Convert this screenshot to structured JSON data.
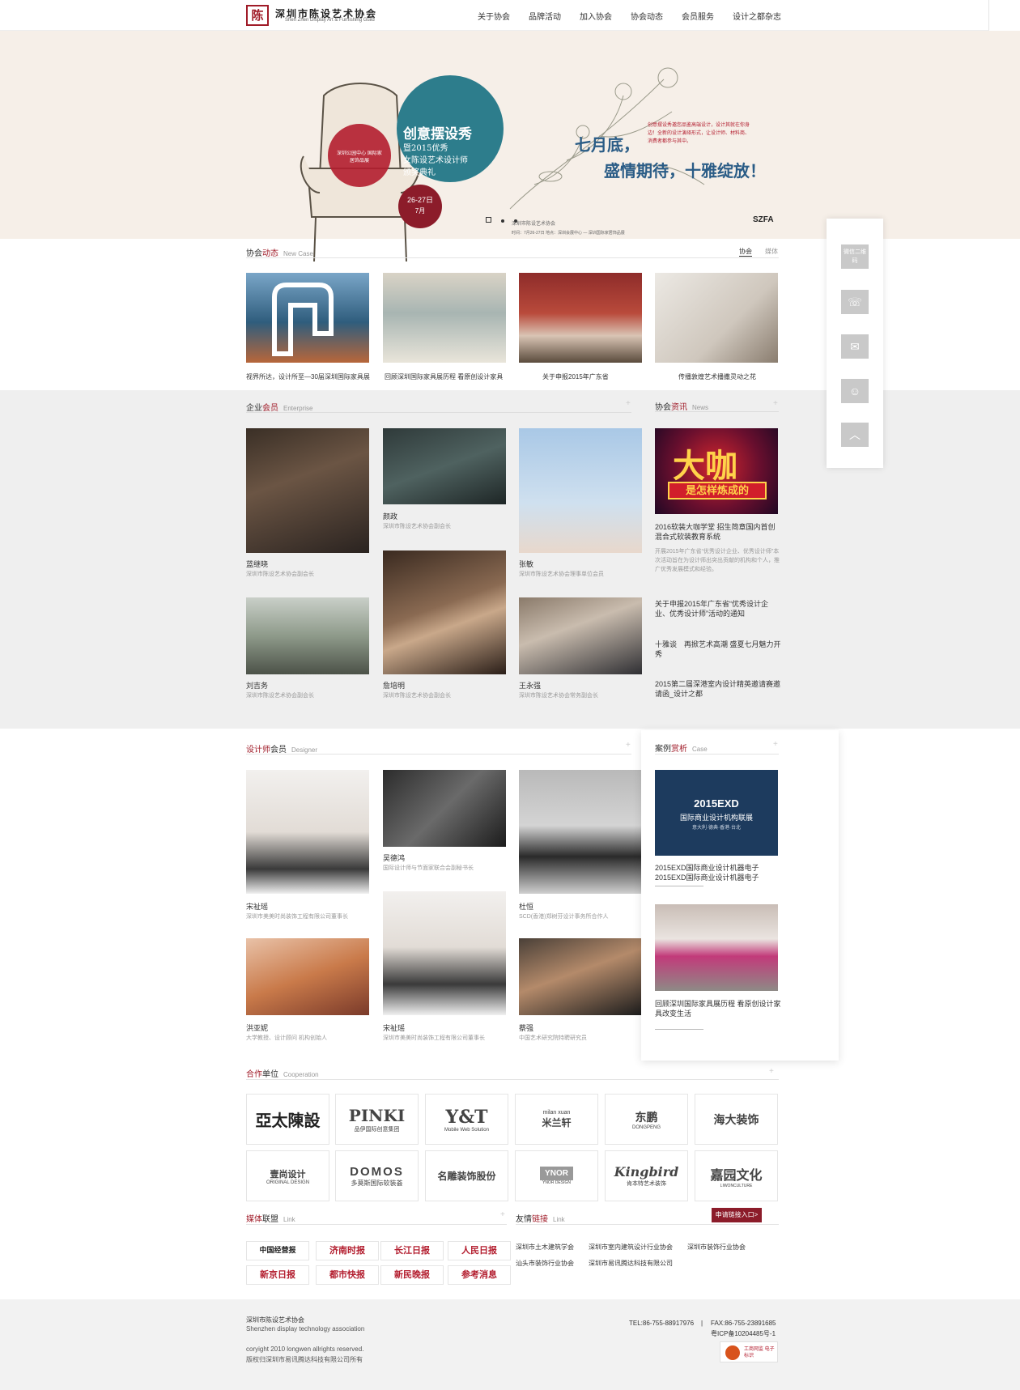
{
  "header": {
    "logo_char": "陈",
    "logo_cn": "深圳市陈设艺术协会",
    "logo_en": "Shen Zhen Display Art & Furnishing Guild",
    "nav": [
      "关于协会",
      "品牌活动",
      "加入协会",
      "协会动态",
      "会员服务",
      "设计之都杂志"
    ]
  },
  "banner": {
    "title": "创意摆设秀",
    "sub1": "暨2015优秀",
    "sub2": "女陈设艺术设计师",
    "sub3": "颁奖典礼",
    "red_text": "深圳公园中心 国际家居饰品展",
    "date_days": "26-27日",
    "date_month": "7月",
    "main1": "七月底，",
    "main2": "盛情期待，十雅绽放！",
    "desc": "创意摆设秀邀您品鉴高端设计，设计其就在你身边！全新的设计演绎形式，让设计师、材料商、消费者都参与其中。",
    "footer_line": "时间：7月26-27日  地点：深圳会展中心 — 深圳国际家居饰品展",
    "org1": "深圳市陈设艺术协会",
    "org2": "SZFA"
  },
  "dynamics": {
    "title_a": "协会",
    "title_b": "动态",
    "title_en": "New Case",
    "tab1": "协会",
    "tab2": "媒体",
    "items": [
      "视界所达，设计所至—30届深圳国际家具展",
      "回顾深圳国际家具展历程 看原创设计家具",
      "关于申报2015年广东省",
      "传播敦煌艺术播撒灵动之花"
    ]
  },
  "enterprise": {
    "title_a": "企业",
    "title_b": "会员",
    "title_en": "Enterprise",
    "plus": "+",
    "members": [
      {
        "name": "蓝继晓",
        "role": "深圳市陈设艺术协会副会长"
      },
      {
        "name": "颜政",
        "role": "深圳市陈设艺术协会副会长"
      },
      {
        "name": "张敏",
        "role": "深圳市陈设艺术协会理事单位会员"
      },
      {
        "name": "刘吉务",
        "role": "深圳市陈设艺术协会副会长"
      },
      {
        "name": "詹培明",
        "role": "深圳市陈设艺术协会副会长"
      },
      {
        "name": "王永强",
        "role": "深圳市陈设艺术协会常务副会长"
      }
    ]
  },
  "news": {
    "title_a": "协会",
    "title_b": "资讯",
    "title_en": "News",
    "plus": "+",
    "feature_img_text1": "大咖",
    "feature_img_text2": "是怎样炼成的",
    "feature_title": "2016软装大咖学堂 招生简章国内首创混合式软装教育系统",
    "feature_desc": "开展2015年广东省“优秀设计企业、优秀设计师”本次活动旨在为设计师出突出贡献的机构和个人，推广优秀发展模式和经验。",
    "list": [
      "关于申报2015年广东省“优秀设计企业、优秀设计师”活动的通知",
      "十雅谈　再掀艺术高潮 盛夏七月魅力开秀",
      "2015第二届深港室内设计精英邀请赛邀请函_设计之都"
    ]
  },
  "designer": {
    "title_a": "设计师",
    "title_b": "会员",
    "title_en": "Designer",
    "plus": "+",
    "members": [
      {
        "name": "宋祉瑶",
        "role": "深圳市美美时尚装饰工程有限公司董事长"
      },
      {
        "name": "吴德鸿",
        "role": "国际设计师与节面家联合会副秘书长"
      },
      {
        "name": "杜恒",
        "role": "SCD(香港)郑树芬设计事务所合作人"
      },
      {
        "name": "洪亚妮",
        "role": "大学教授、设计顾问 机构创始人"
      },
      {
        "name": "宋祉瑶",
        "role": "深圳市美美时尚装饰工程有限公司董事长"
      },
      {
        "name": "蔡强",
        "role": "中国艺术研究院特聘研究员"
      }
    ]
  },
  "cases": {
    "title_a": "案例",
    "title_b": "赏析",
    "title_en": "Case",
    "plus": "+",
    "exd_l1": "2015EXD",
    "exd_l2": "国际商业设计机构联展",
    "exd_l3": "意大利·德典·香港·台北",
    "items": [
      "2015EXD国际商业设计机器电子2015EXD国际商业设计机器电子",
      "回顾深圳国际家具展历程 看原创设计家具改变生活"
    ]
  },
  "coop": {
    "title_a": "合作",
    "title_b": "单位",
    "title_en": "Cooperation",
    "plus": "+",
    "logos": [
      {
        "main": "亞太陳設",
        "sub": ""
      },
      {
        "main": "PINKI",
        "sub": "品伊国际创意集团"
      },
      {
        "main": "Y&T",
        "sub": "Mobile Web Solution"
      },
      {
        "main": "米兰轩",
        "sub": "milan xuan"
      },
      {
        "main": "东鹏",
        "sub": "DONGPENG"
      },
      {
        "main": "海大装饰",
        "sub": ""
      },
      {
        "main": "壹尚设计",
        "sub": "ORIGINAL DESIGN"
      },
      {
        "main": "DOMOS",
        "sub": "多莫斯国际软装荟"
      },
      {
        "main": "名雕装饰股份",
        "sub": ""
      },
      {
        "main": "YNOR",
        "sub": "YNOR DESIGN"
      },
      {
        "main": "Kingbird",
        "sub": "肯本特艺术装饰"
      },
      {
        "main": "嘉园文化",
        "sub": "LIWONCULTURE"
      }
    ]
  },
  "media": {
    "title_a": "媒体",
    "title_b": "联盟",
    "title_en": "Link",
    "plus": "+",
    "items": [
      "中国经营报",
      "济南时报",
      "长江日报",
      "人民日报",
      "新京日报",
      "都市快报",
      "新民晚报",
      "参考消息"
    ]
  },
  "friends": {
    "title_a": "友情",
    "title_b": "链接",
    "title_en": "Link",
    "apply": "申请链接入口>",
    "links": [
      "深圳市土木建筑学会",
      "深圳市室内建筑设计行业协会",
      "深圳市装饰行业协会",
      "汕头市装饰行业协会",
      "深圳市易讯腾达科技有限公司"
    ]
  },
  "footer": {
    "org_cn": "深圳市陈设艺术协会",
    "org_en": "Shenzhen display technology association",
    "copy1": "coryight 2010 longwen allrights reserved.",
    "copy2": "版权归深圳市易讯腾达科技有限公司所有",
    "tel": "TEL:86-755-88917976",
    "sep": "|",
    "fax": "FAX:86-755-23891685",
    "icp": "粤ICP备10204485号-1",
    "badge": "工商网监 电子标识"
  },
  "side": {
    "qr": "微信二维码",
    "phone_icon": "phone-icon",
    "mail_icon": "mail-icon",
    "qq_icon": "qq-icon",
    "top_icon": "back-to-top-icon"
  },
  "colors": {
    "accent": "#a01b28",
    "teal": "#2d7d8c",
    "banner_bg": "#f6efe8",
    "gray_bg": "#efefef"
  }
}
